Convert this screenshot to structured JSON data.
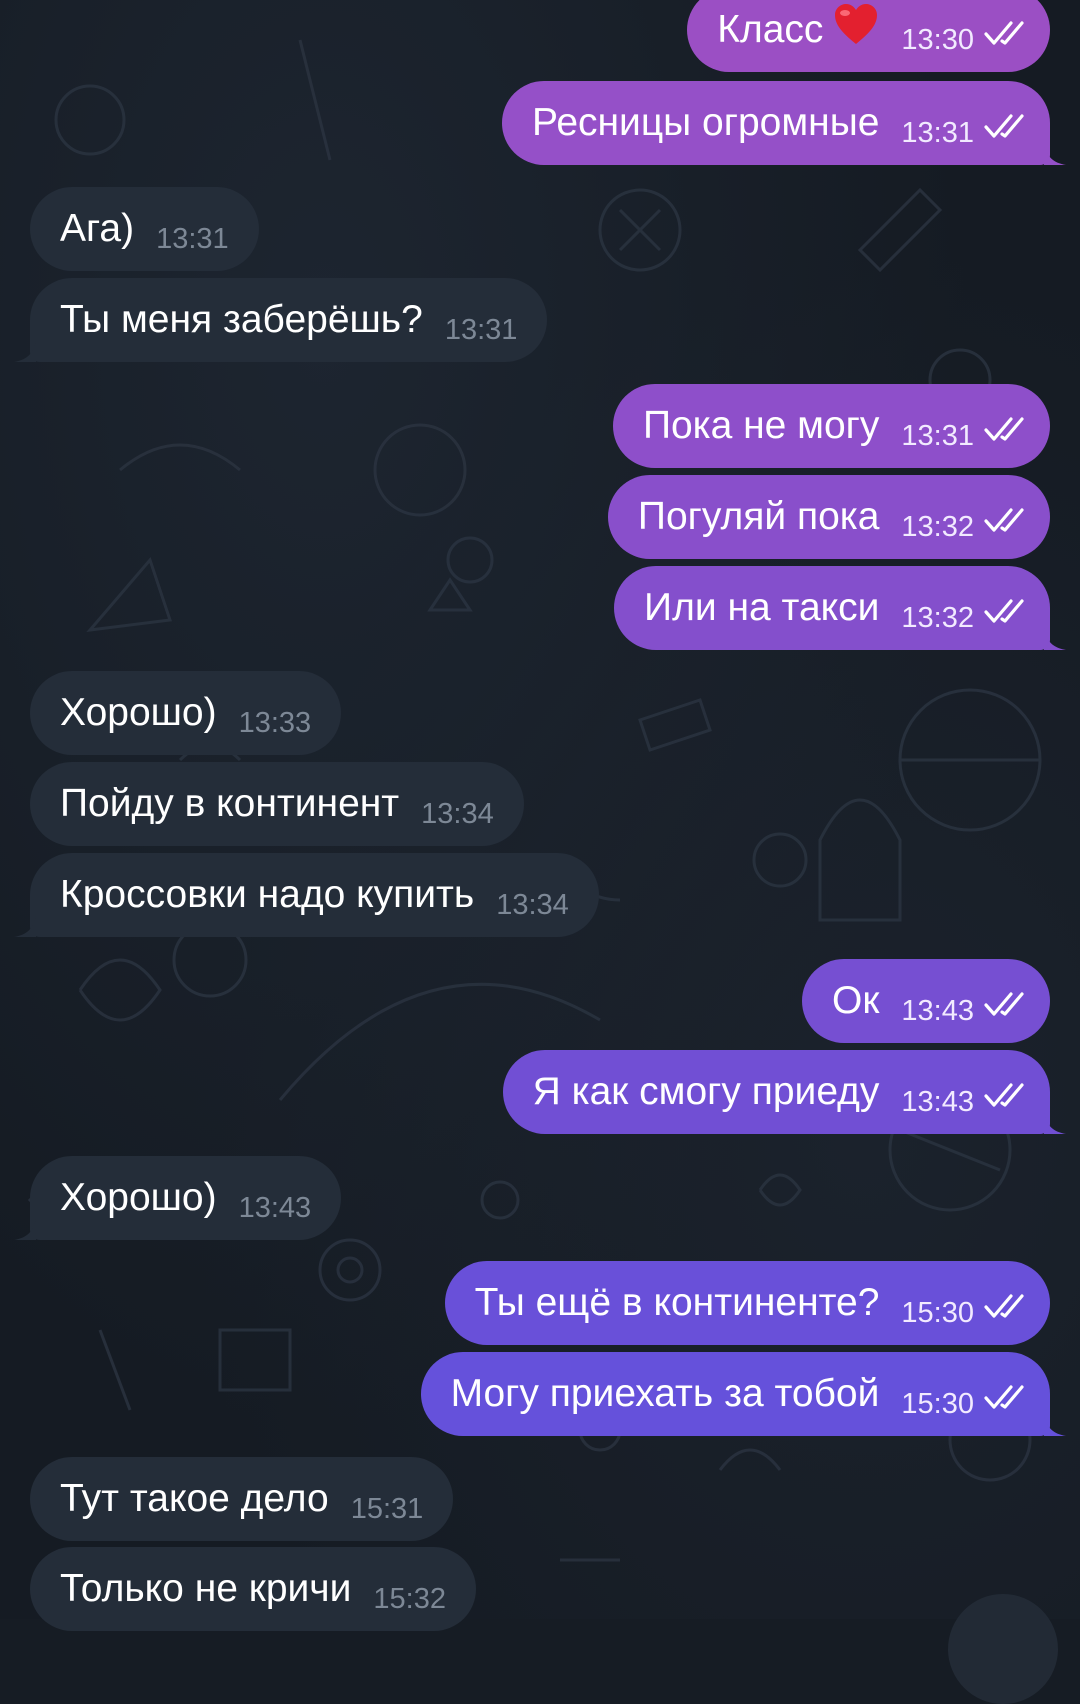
{
  "chat": {
    "messages": [
      {
        "id": 0,
        "direction": "out",
        "text": "Класс",
        "time": "13:30",
        "emoji": "heart",
        "color": "#9b4fc4"
      },
      {
        "id": 1,
        "direction": "out",
        "text": "Ресницы огромные",
        "time": "13:31",
        "color": "#9550c8"
      },
      {
        "id": 2,
        "direction": "in",
        "text": "Ага)",
        "time": "13:31"
      },
      {
        "id": 3,
        "direction": "in",
        "text": "Ты меня заберёшь?",
        "time": "13:31"
      },
      {
        "id": 4,
        "direction": "out",
        "text": "Пока не могу",
        "time": "13:31",
        "color": "#8e4fca"
      },
      {
        "id": 5,
        "direction": "out",
        "text": "Погуляй пока",
        "time": "13:32",
        "color": "#894fcb"
      },
      {
        "id": 6,
        "direction": "out",
        "text": "Или на такси",
        "time": "13:32",
        "color": "#844fcc"
      },
      {
        "id": 7,
        "direction": "in",
        "text": "Хорошо)",
        "time": "13:33"
      },
      {
        "id": 8,
        "direction": "in",
        "text": "Пойду в континент",
        "time": "13:34"
      },
      {
        "id": 9,
        "direction": "in",
        "text": "Кроссовки надо купить",
        "time": "13:34"
      },
      {
        "id": 10,
        "direction": "out",
        "text": "Ок",
        "time": "13:43",
        "color": "#764fd2"
      },
      {
        "id": 11,
        "direction": "out",
        "text": "Я как смогу приеду",
        "time": "13:43",
        "color": "#714fd4"
      },
      {
        "id": 12,
        "direction": "in",
        "text": "Хорошо)",
        "time": "13:43"
      },
      {
        "id": 13,
        "direction": "out",
        "text": "Ты ещё в континенте?",
        "time": "15:30",
        "color": "#6950d9"
      },
      {
        "id": 14,
        "direction": "out",
        "text": "Могу приехать за тобой",
        "time": "15:30",
        "color": "#6551db"
      },
      {
        "id": 15,
        "direction": "in",
        "text": "Тут такое дело",
        "time": "15:31"
      },
      {
        "id": 16,
        "direction": "in",
        "text": "Только не кричи",
        "time": "15:32"
      }
    ]
  },
  "colors": {
    "background": "#151b23",
    "incoming_bubble": "#242d39",
    "incoming_time": "#7d8896",
    "outgoing_text": "#ffffff",
    "read_check": "#ffffff"
  },
  "icons": {
    "read_status": "double-check-icon",
    "emoji": "red-heart-icon",
    "scroll_down": "scroll-down-button"
  }
}
